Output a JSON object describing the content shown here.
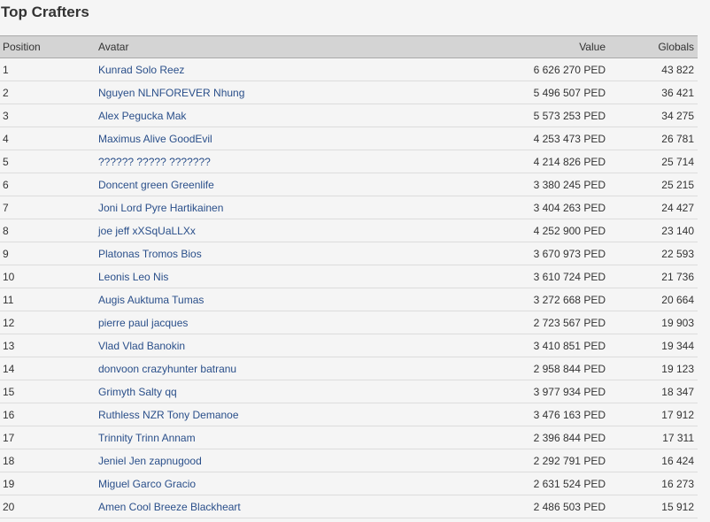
{
  "page": {
    "title": "Top Crafters"
  },
  "table": {
    "headers": {
      "position": "Position",
      "avatar": "Avatar",
      "value": "Value",
      "globals": "Globals"
    },
    "rows": [
      {
        "position": "1",
        "avatar": "Kunrad Solo Reez",
        "value": "6 626 270 PED",
        "globals": "43 822"
      },
      {
        "position": "2",
        "avatar": "Nguyen NLNFOREVER Nhung",
        "value": "5 496 507 PED",
        "globals": "36 421"
      },
      {
        "position": "3",
        "avatar": "Alex Pegucka Mak",
        "value": "5 573 253 PED",
        "globals": "34 275"
      },
      {
        "position": "4",
        "avatar": "Maximus Alive GoodEvil",
        "value": "4 253 473 PED",
        "globals": "26 781"
      },
      {
        "position": "5",
        "avatar": "?????? ????? ???????",
        "value": "4 214 826 PED",
        "globals": "25 714"
      },
      {
        "position": "6",
        "avatar": "Doncent green Greenlife",
        "value": "3 380 245 PED",
        "globals": "25 215"
      },
      {
        "position": "7",
        "avatar": "Joni Lord Pyre Hartikainen",
        "value": "3 404 263 PED",
        "globals": "24 427"
      },
      {
        "position": "8",
        "avatar": "joe jeff xXSqUaLLXx",
        "value": "4 252 900 PED",
        "globals": "23 140"
      },
      {
        "position": "9",
        "avatar": "Platonas Tromos Bios",
        "value": "3 670 973 PED",
        "globals": "22 593"
      },
      {
        "position": "10",
        "avatar": "Leonis Leo Nis",
        "value": "3 610 724 PED",
        "globals": "21 736"
      },
      {
        "position": "11",
        "avatar": "Augis Auktuma Tumas",
        "value": "3 272 668 PED",
        "globals": "20 664"
      },
      {
        "position": "12",
        "avatar": "pierre paul jacques",
        "value": "2 723 567 PED",
        "globals": "19 903"
      },
      {
        "position": "13",
        "avatar": "Vlad Vlad Banokin",
        "value": "3 410 851 PED",
        "globals": "19 344"
      },
      {
        "position": "14",
        "avatar": "donvoon crazyhunter batranu",
        "value": "2 958 844 PED",
        "globals": "19 123"
      },
      {
        "position": "15",
        "avatar": "Grimyth Salty qq",
        "value": "3 977 934 PED",
        "globals": "18 347"
      },
      {
        "position": "16",
        "avatar": "Ruthless NZR Tony Demanoe",
        "value": "3 476 163 PED",
        "globals": "17 912"
      },
      {
        "position": "17",
        "avatar": "Trinnity Trinn Annam",
        "value": "2 396 844 PED",
        "globals": "17 311"
      },
      {
        "position": "18",
        "avatar": "Jeniel Jen zapnugood",
        "value": "2 292 791 PED",
        "globals": "16 424"
      },
      {
        "position": "19",
        "avatar": "Miguel Garco Gracio",
        "value": "2 631 524 PED",
        "globals": "16 273"
      },
      {
        "position": "20",
        "avatar": "Amen Cool Breeze Blackheart",
        "value": "2 486 503 PED",
        "globals": "15 912"
      }
    ]
  },
  "colors": {
    "background": "#f5f5f5",
    "header_background": "#d4d4d4",
    "link": "#2a4f8a",
    "text": "#333333",
    "row_divider": "#dcdcdc"
  }
}
